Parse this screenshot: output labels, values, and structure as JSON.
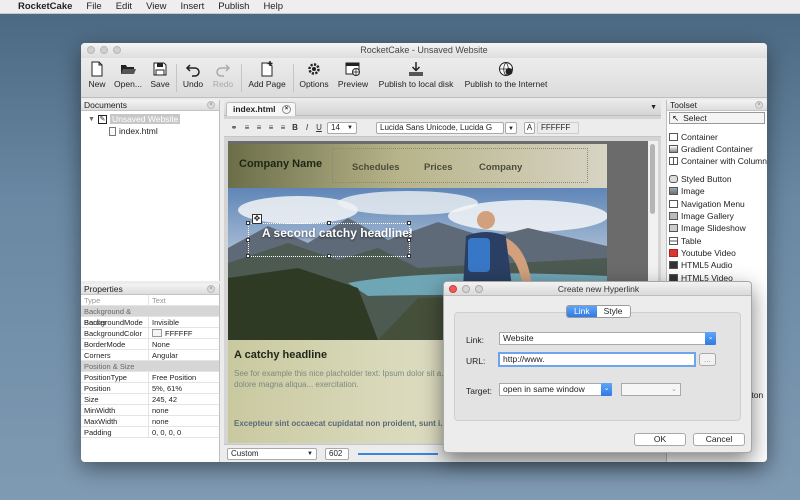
{
  "menubar": {
    "apple": "",
    "app_name": "RocketCake",
    "items": [
      "File",
      "Edit",
      "View",
      "Insert",
      "Publish",
      "Help"
    ]
  },
  "window": {
    "title": "RocketCake - Unsaved Website"
  },
  "toolbar": {
    "new": "New",
    "open": "Open...",
    "save": "Save",
    "undo": "Undo",
    "redo": "Redo",
    "add_page": "Add Page",
    "options": "Options",
    "preview": "Preview",
    "publish_local": "Publish to local disk",
    "publish_internet": "Publish to the Internet"
  },
  "documents": {
    "title": "Documents",
    "root": "Unsaved Website",
    "file": "index.html"
  },
  "properties": {
    "title": "Properties",
    "header": {
      "k": "Type",
      "v": "Text"
    },
    "rows": [
      {
        "k": "Background & Border",
        "v": "",
        "section": true
      },
      {
        "k": "BackgroundMode",
        "v": "Invisible"
      },
      {
        "k": "BackgroundColor",
        "v": "FFFFFF",
        "swatch": true
      },
      {
        "k": "BorderMode",
        "v": "None"
      },
      {
        "k": "Corners",
        "v": "Angular"
      },
      {
        "k": "Position & Size",
        "v": "",
        "section": true
      },
      {
        "k": "PositionType",
        "v": "Free Position"
      },
      {
        "k": "Position",
        "v": "5%, 61%"
      },
      {
        "k": "Size",
        "v": "245, 42"
      },
      {
        "k": "MinWidth",
        "v": "none"
      },
      {
        "k": "MaxWidth",
        "v": "none"
      },
      {
        "k": "Padding",
        "v": "0, 0, 0, 0"
      }
    ]
  },
  "editor": {
    "tab": "index.html",
    "format": {
      "font_size": "14",
      "font_family": "Lucida Sans Unicode, Lucida G",
      "color_label": "A",
      "color": "FFFFFF"
    },
    "page": {
      "brand": "Company Name",
      "nav": [
        "Schedules",
        "Prices",
        "Company"
      ],
      "hero_text": "A second catchy headline!",
      "headline": "A catchy headline",
      "paragraph": "See for example this nice placholder text: Ipsum dolor sit a... eiusmod tempor incididunt ut labore et dolore magna aliqua... exercitation.",
      "bold_text": "Excepteur sint occaecat cupidatat non proident, sunt i... est laborum."
    },
    "status": {
      "mode": "Custom",
      "width": "602"
    }
  },
  "toolset": {
    "title": "Toolset",
    "items": [
      "Select",
      "Container",
      "Gradient Container",
      "Container with Column",
      "Styled Button",
      "Image",
      "Navigation Menu",
      "Image Gallery",
      "Image Slideshow",
      "Table",
      "Youtube Video",
      "HTML5 Audio",
      "HTML5 Video"
    ],
    "partial_button": "tton"
  },
  "dialog": {
    "title": "Create new Hyperlink",
    "tabs": [
      "Link",
      "Style"
    ],
    "link_label": "Link:",
    "link_value": "Website",
    "url_label": "URL:",
    "url_value": "http://www.",
    "browse": "...",
    "target_label": "Target:",
    "target_value": "open in same window",
    "ok": "OK",
    "cancel": "Cancel"
  }
}
